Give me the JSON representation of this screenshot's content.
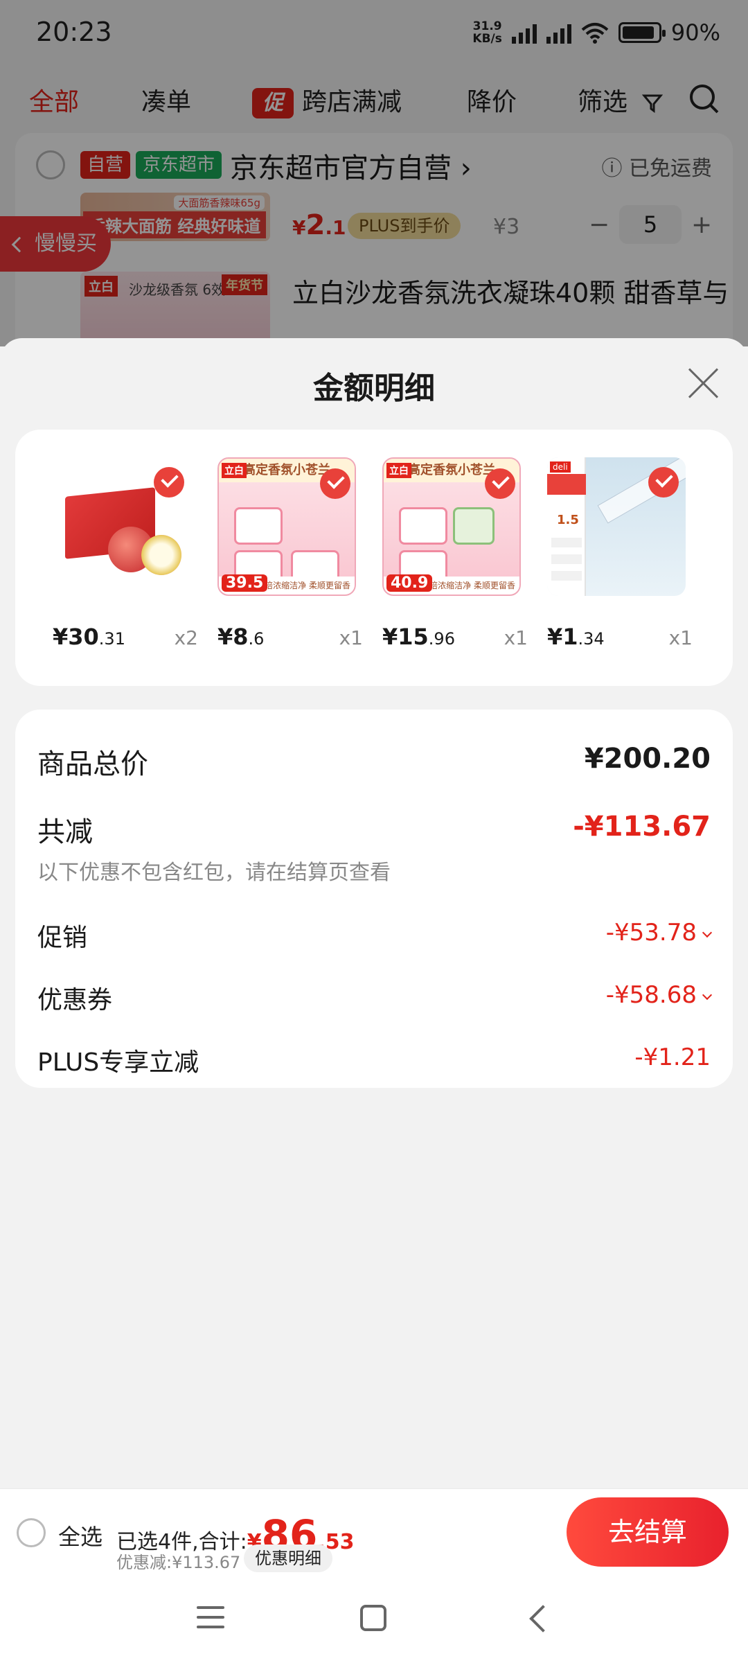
{
  "status_bar": {
    "time": "20:23",
    "net_speed_value": "31.9",
    "net_speed_unit": "KB/s",
    "battery": "90%"
  },
  "cart_tabs": {
    "all": "全部",
    "combine": "凑单",
    "promo_badge": "促",
    "cross_store": "跨店满减",
    "price_drop": "降价",
    "filter": "筛选"
  },
  "shop": {
    "tag_self": "自营",
    "tag_market": "京东超市",
    "name": "京东超市官方自营 ›",
    "shipping": "ⓘ 已免运费"
  },
  "bg_products": [
    {
      "image_top": "大面筋香辣味65g",
      "image_text": "香辣大面筋 经典好味道",
      "price_cur": "¥",
      "price_int": "2",
      "price_dec": ".1",
      "plus_label": "PLUS到手价",
      "orig_price": "¥3",
      "qty": "5"
    },
    {
      "image_brand": "立白",
      "image_sub": "沙龙级香氛 6效",
      "image_badge": "年货节",
      "title": "立白沙龙香氛洗衣凝珠40颗 甜香草与"
    }
  ],
  "float_tab": {
    "label": "慢慢买"
  },
  "sheet": {
    "title": "金额明细",
    "items": [
      {
        "price_int": "¥30",
        "price_dec": ".31",
        "qty": "x2"
      },
      {
        "price_int": "¥8",
        "price_dec": ".6",
        "qty": "x1",
        "img_brand": "立白",
        "img_top": "高定香氛小苍兰",
        "img_price": "39.5",
        "img_bottom": "10倍浓缩洁净 柔顺更留香"
      },
      {
        "price_int": "¥15",
        "price_dec": ".96",
        "qty": "x1",
        "img_brand": "立白",
        "img_top": "高定香氛小苍兰",
        "img_price": "40.9",
        "img_bottom": "10倍浓缩洁净 柔顺更留香"
      },
      {
        "price_int": "¥1",
        "price_dec": ".34",
        "qty": "x1",
        "img_brand": "deli",
        "img_num": "1.5"
      }
    ],
    "summary": {
      "total_label": "商品总价",
      "total_value": "¥200.20",
      "reduce_label": "共减",
      "reduce_value": "-¥113.67",
      "note": "以下优惠不包含红包，请在结算页查看",
      "promo_label": "促销",
      "promo_value": "-¥53.78",
      "coupon_label": "优惠券",
      "coupon_value": "-¥58.68",
      "plus_label": "PLUS专享立减",
      "plus_value": "-¥1.21"
    }
  },
  "checkout": {
    "select_all": "全选",
    "selected_text": "已选4件,合计:",
    "total_cur": "¥",
    "total_int": "86",
    "total_dec": ".53",
    "discount_text": "优惠减:¥113.67",
    "detail_button": "优惠明细",
    "checkout_button": "去结算"
  },
  "colors": {
    "accent_red": "#e2231a",
    "market_green": "#1aab5a",
    "sheet_bg": "#f2f2f2"
  },
  "icons": [
    "wifi-icon",
    "signal-icon",
    "battery-icon",
    "filter-icon",
    "search-icon",
    "info-icon",
    "close-icon",
    "check-icon",
    "chevron-left-icon",
    "menu-nav-icon",
    "home-nav-icon",
    "back-nav-icon"
  ]
}
